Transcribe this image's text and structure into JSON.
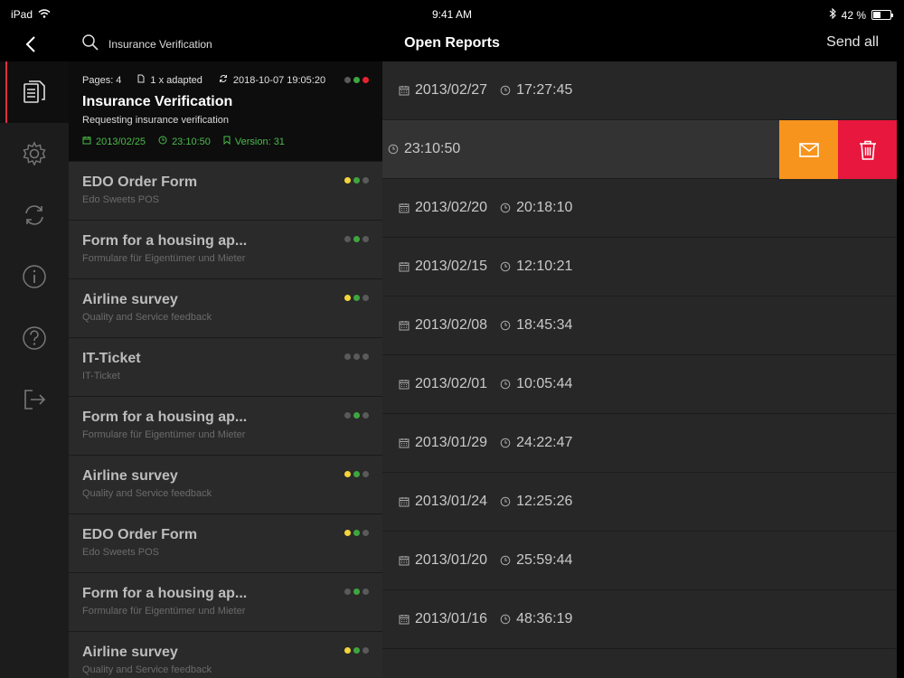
{
  "status_bar": {
    "device": "iPad",
    "time": "9:41 AM",
    "battery": "42 %",
    "battery_level": 0.42
  },
  "nav": {
    "search_value": "Insurance Verification",
    "title": "Open Reports",
    "send_all": "Send all"
  },
  "rail": {
    "items": [
      "document-icon",
      "gear-icon",
      "sync-icon",
      "info-icon",
      "help-icon",
      "logout-icon"
    ]
  },
  "selected": {
    "pages": "Pages: 4",
    "adapted": "1 x adapted",
    "synced": "2018-10-07 19:05:20",
    "title": "Insurance Verification",
    "subtitle": "Requesting insurance verification",
    "date": "2013/02/25",
    "time": "23:10:50",
    "version": "Version: 31",
    "status": [
      "gray",
      "green",
      "red"
    ]
  },
  "list": [
    {
      "title": "EDO Order Form",
      "subtitle": "Edo Sweets POS",
      "status": [
        "yellow",
        "green",
        "gray"
      ]
    },
    {
      "title": "Form for a housing ap...",
      "subtitle": "Formulare für Eigentümer und Mieter",
      "status": [
        "gray",
        "green",
        "gray"
      ]
    },
    {
      "title": "Airline survey",
      "subtitle": "Quality and Service feedback",
      "status": [
        "yellow",
        "green",
        "gray"
      ]
    },
    {
      "title": "IT-Ticket",
      "subtitle": "IT-Ticket",
      "status": [
        "gray",
        "gray",
        "gray"
      ]
    },
    {
      "title": "Form for a housing ap...",
      "subtitle": "Formulare für Eigentümer und Mieter",
      "status": [
        "gray",
        "green",
        "gray"
      ]
    },
    {
      "title": "Airline survey",
      "subtitle": "Quality and Service feedback",
      "status": [
        "yellow",
        "green",
        "gray"
      ]
    },
    {
      "title": "EDO Order Form",
      "subtitle": "Edo Sweets POS",
      "status": [
        "yellow",
        "green",
        "gray"
      ]
    },
    {
      "title": "Form for a housing ap...",
      "subtitle": "Formulare für Eigentümer und Mieter",
      "status": [
        "gray",
        "green",
        "gray"
      ]
    },
    {
      "title": "Airline survey",
      "subtitle": "Quality and Service feedback",
      "status": [
        "yellow",
        "green",
        "gray"
      ]
    }
  ],
  "reports": [
    {
      "date": "2013/02/27",
      "time": "17:27:45"
    },
    {
      "date": "",
      "time": "23:10:50",
      "swiped": true
    },
    {
      "date": "2013/02/20",
      "time": "20:18:10"
    },
    {
      "date": "2013/02/15",
      "time": "12:10:21"
    },
    {
      "date": "2013/02/08",
      "time": "18:45:34"
    },
    {
      "date": "2013/02/01",
      "time": "10:05:44"
    },
    {
      "date": "2013/01/29",
      "time": "24:22:47"
    },
    {
      "date": "2013/01/24",
      "time": "12:25:26"
    },
    {
      "date": "2013/01/20",
      "time": "25:59:44"
    },
    {
      "date": "2013/01/16",
      "time": "48:36:19"
    }
  ],
  "colors": {
    "accent_red": "#e0303e",
    "mail_orange": "#f7941d",
    "delete_red": "#e8173d",
    "info_green": "#4cba4c"
  }
}
